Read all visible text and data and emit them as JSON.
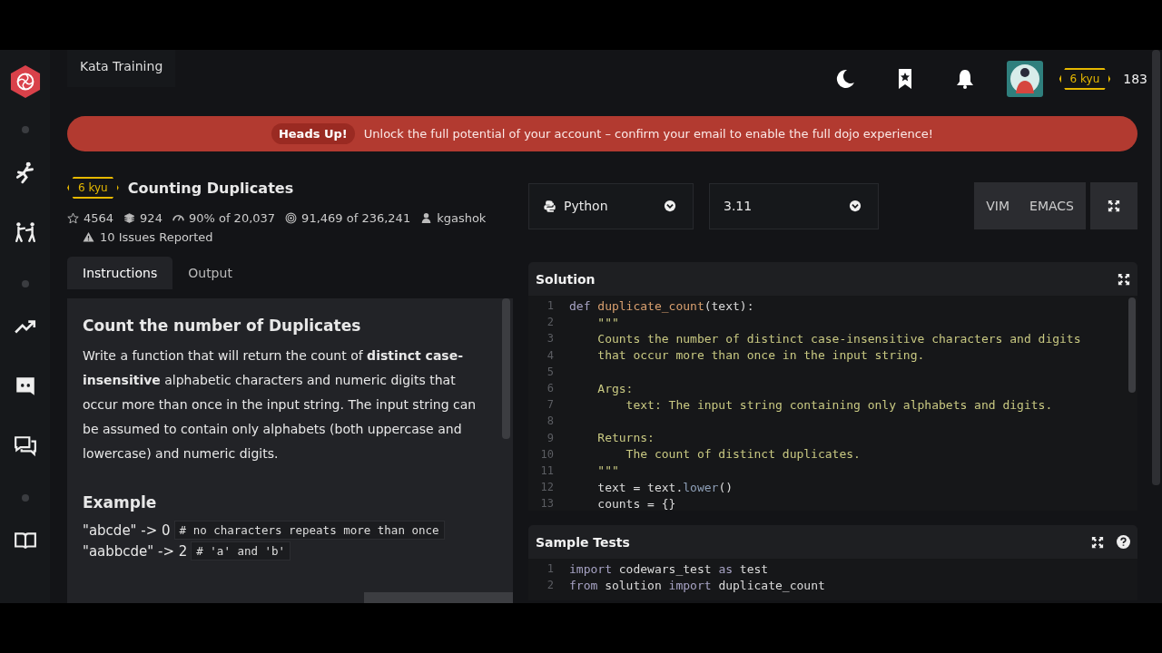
{
  "header": {
    "tab": "Kata Training",
    "rank": "6 kyu",
    "honor": "183"
  },
  "banner": {
    "badge": "Heads Up!",
    "message": "Unlock the full potential of your account – confirm your email to enable the full dojo experience!"
  },
  "kata": {
    "rank": "6 kyu",
    "title": "Counting Duplicates",
    "stats": [
      {
        "kind": "star",
        "text": "4564"
      },
      {
        "kind": "stack",
        "text": "924"
      },
      {
        "kind": "gauge",
        "text": "90% of 20,037"
      },
      {
        "kind": "target",
        "text": "91,469 of 236,241"
      },
      {
        "kind": "user",
        "text": "kgashok"
      }
    ],
    "issues": "10 Issues Reported"
  },
  "tabs": [
    {
      "label": "Instructions",
      "selected": true
    },
    {
      "label": "Output",
      "selected": false
    }
  ],
  "instructions": {
    "heading": "Count the number of Duplicates",
    "paragraph": "Write a function that will return the count of **distinct case-insensitive** alphabetic characters and numeric digits that occur more than once in the input string. The input string can be assumed to contain only alphabets (both uppercase and lowercase) and numeric digits.",
    "example_heading": "Example",
    "examples": [
      {
        "text": "\"abcde\" -> 0",
        "comment": "# no characters repeats more than once"
      },
      {
        "text": "\"aabbcde\" -> 2",
        "comment": "# 'a' and 'b'"
      }
    ]
  },
  "editor": {
    "language": "Python",
    "version": "3.11",
    "modes": [
      "VIM",
      "EMACS"
    ]
  },
  "solution": {
    "title": "Solution",
    "lines": [
      {
        "num": "1",
        "tokens": [
          {
            "kind": "kw",
            "text": "def "
          },
          {
            "kind": "fn",
            "text": "duplicate_count"
          },
          {
            "kind": "plain",
            "text": "(text):"
          }
        ]
      },
      {
        "num": "2",
        "tokens": [
          {
            "kind": "doc",
            "text": "    \"\"\""
          }
        ]
      },
      {
        "num": "3",
        "tokens": [
          {
            "kind": "doc",
            "text": "    Counts the number of distinct case-insensitive characters and digits"
          }
        ]
      },
      {
        "num": "4",
        "tokens": [
          {
            "kind": "doc",
            "text": "    that occur more than once in the input string."
          }
        ]
      },
      {
        "num": "5"
      },
      {
        "num": "6",
        "tokens": [
          {
            "kind": "doc",
            "text": "    Args:"
          }
        ]
      },
      {
        "num": "7",
        "tokens": [
          {
            "kind": "doc",
            "text": "        text: The input string containing only alphabets and digits."
          }
        ]
      },
      {
        "num": "8"
      },
      {
        "num": "9",
        "tokens": [
          {
            "kind": "doc",
            "text": "    Returns:"
          }
        ]
      },
      {
        "num": "10",
        "tokens": [
          {
            "kind": "doc",
            "text": "        The count of distinct duplicates."
          }
        ]
      },
      {
        "num": "11",
        "tokens": [
          {
            "kind": "doc",
            "text": "    \"\"\""
          }
        ]
      },
      {
        "num": "12",
        "tokens": [
          {
            "kind": "plain",
            "text": "    text = text."
          },
          {
            "kind": "method",
            "text": "lower"
          },
          {
            "kind": "plain",
            "text": "()"
          }
        ]
      },
      {
        "num": "13",
        "tokens": [
          {
            "kind": "plain",
            "text": "    counts = {}"
          }
        ]
      }
    ]
  },
  "sample_tests": {
    "title": "Sample Tests",
    "lines": [
      {
        "num": "1",
        "tokens": [
          {
            "kind": "kw",
            "text": "import "
          },
          {
            "kind": "plain",
            "text": "codewars_test "
          },
          {
            "kind": "kw",
            "text": "as "
          },
          {
            "kind": "plain",
            "text": "test"
          }
        ]
      },
      {
        "num": "2",
        "tokens": [
          {
            "kind": "kw",
            "text": "from "
          },
          {
            "kind": "plain",
            "text": "solution "
          },
          {
            "kind": "kw",
            "text": "import "
          },
          {
            "kind": "plain",
            "text": "duplicate_count"
          }
        ]
      }
    ]
  }
}
